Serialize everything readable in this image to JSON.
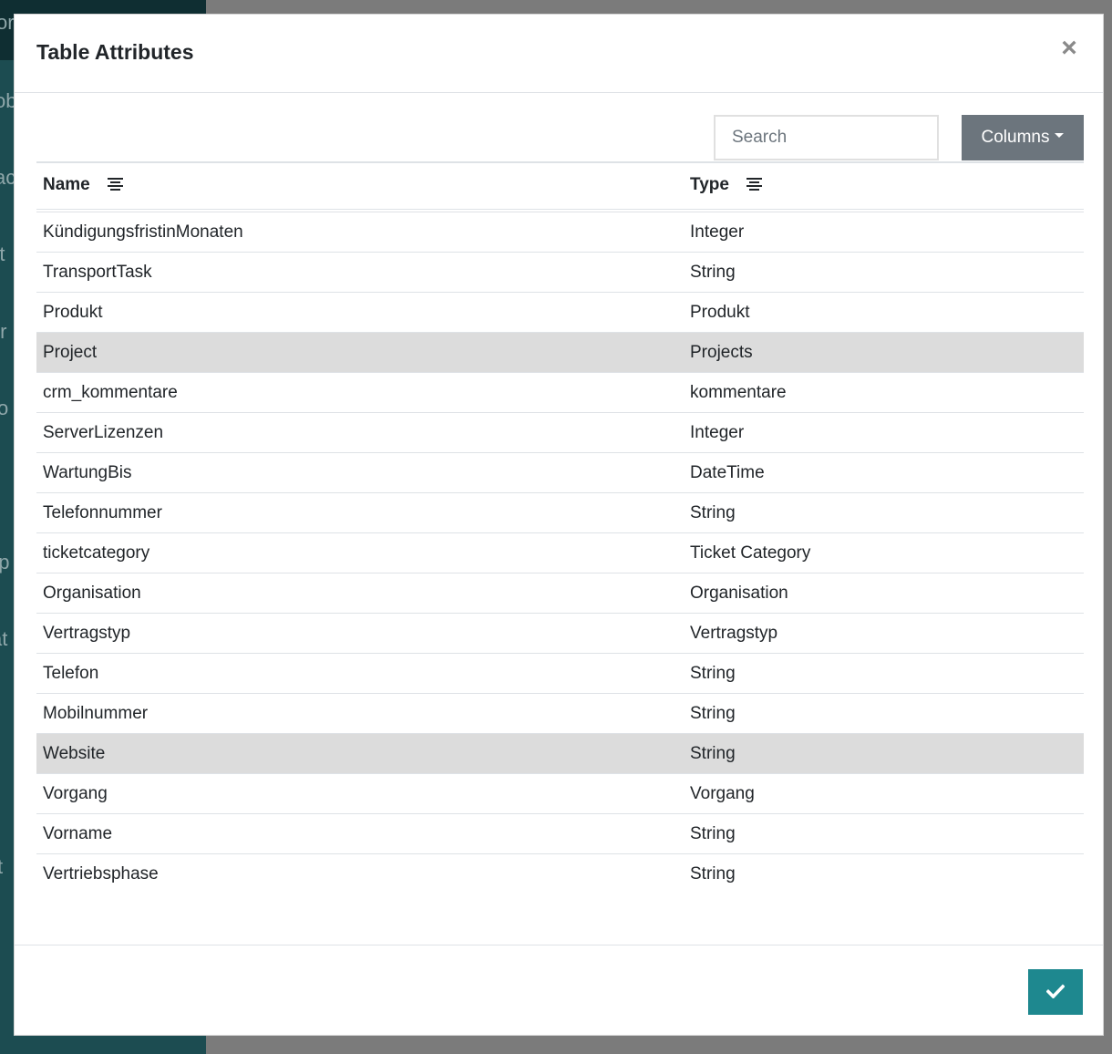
{
  "background": {
    "sidebar_peek": [
      "or",
      "ob",
      "ac",
      "rt",
      "tr",
      "tio",
      "up",
      "at",
      "tit"
    ]
  },
  "modal": {
    "title": "Table Attributes",
    "close_label": "×",
    "search": {
      "placeholder": "Search",
      "value": ""
    },
    "columns_button_label": "Columns",
    "confirm_icon": "check-icon",
    "table": {
      "headers": {
        "name": "Name",
        "type": "Type"
      },
      "rows": [
        {
          "name": "KündigungsfristinMonaten",
          "type": "Integer",
          "highlighted": false
        },
        {
          "name": "TransportTask",
          "type": "String",
          "highlighted": false
        },
        {
          "name": "Produkt",
          "type": "Produkt",
          "highlighted": false
        },
        {
          "name": "Project",
          "type": "Projects",
          "highlighted": true
        },
        {
          "name": "crm_kommentare",
          "type": "kommentare",
          "highlighted": false
        },
        {
          "name": "ServerLizenzen",
          "type": "Integer",
          "highlighted": false
        },
        {
          "name": "WartungBis",
          "type": "DateTime",
          "highlighted": false
        },
        {
          "name": "Telefonnummer",
          "type": "String",
          "highlighted": false
        },
        {
          "name": "ticketcategory",
          "type": "Ticket Category",
          "highlighted": false
        },
        {
          "name": "Organisation",
          "type": "Organisation",
          "highlighted": false
        },
        {
          "name": "Vertragstyp",
          "type": "Vertragstyp",
          "highlighted": false
        },
        {
          "name": "Telefon",
          "type": "String",
          "highlighted": false
        },
        {
          "name": "Mobilnummer",
          "type": "String",
          "highlighted": false
        },
        {
          "name": "Website",
          "type": "String",
          "highlighted": true
        },
        {
          "name": "Vorgang",
          "type": "Vorgang",
          "highlighted": false
        },
        {
          "name": "Vorname",
          "type": "String",
          "highlighted": false
        },
        {
          "name": "Vertriebsphase",
          "type": "String",
          "highlighted": false
        }
      ]
    }
  },
  "colors": {
    "sidebar": "#1c4c51",
    "confirm_button": "#1e888f",
    "columns_button": "#6c757d",
    "row_highlight": "#dcdcdc"
  }
}
